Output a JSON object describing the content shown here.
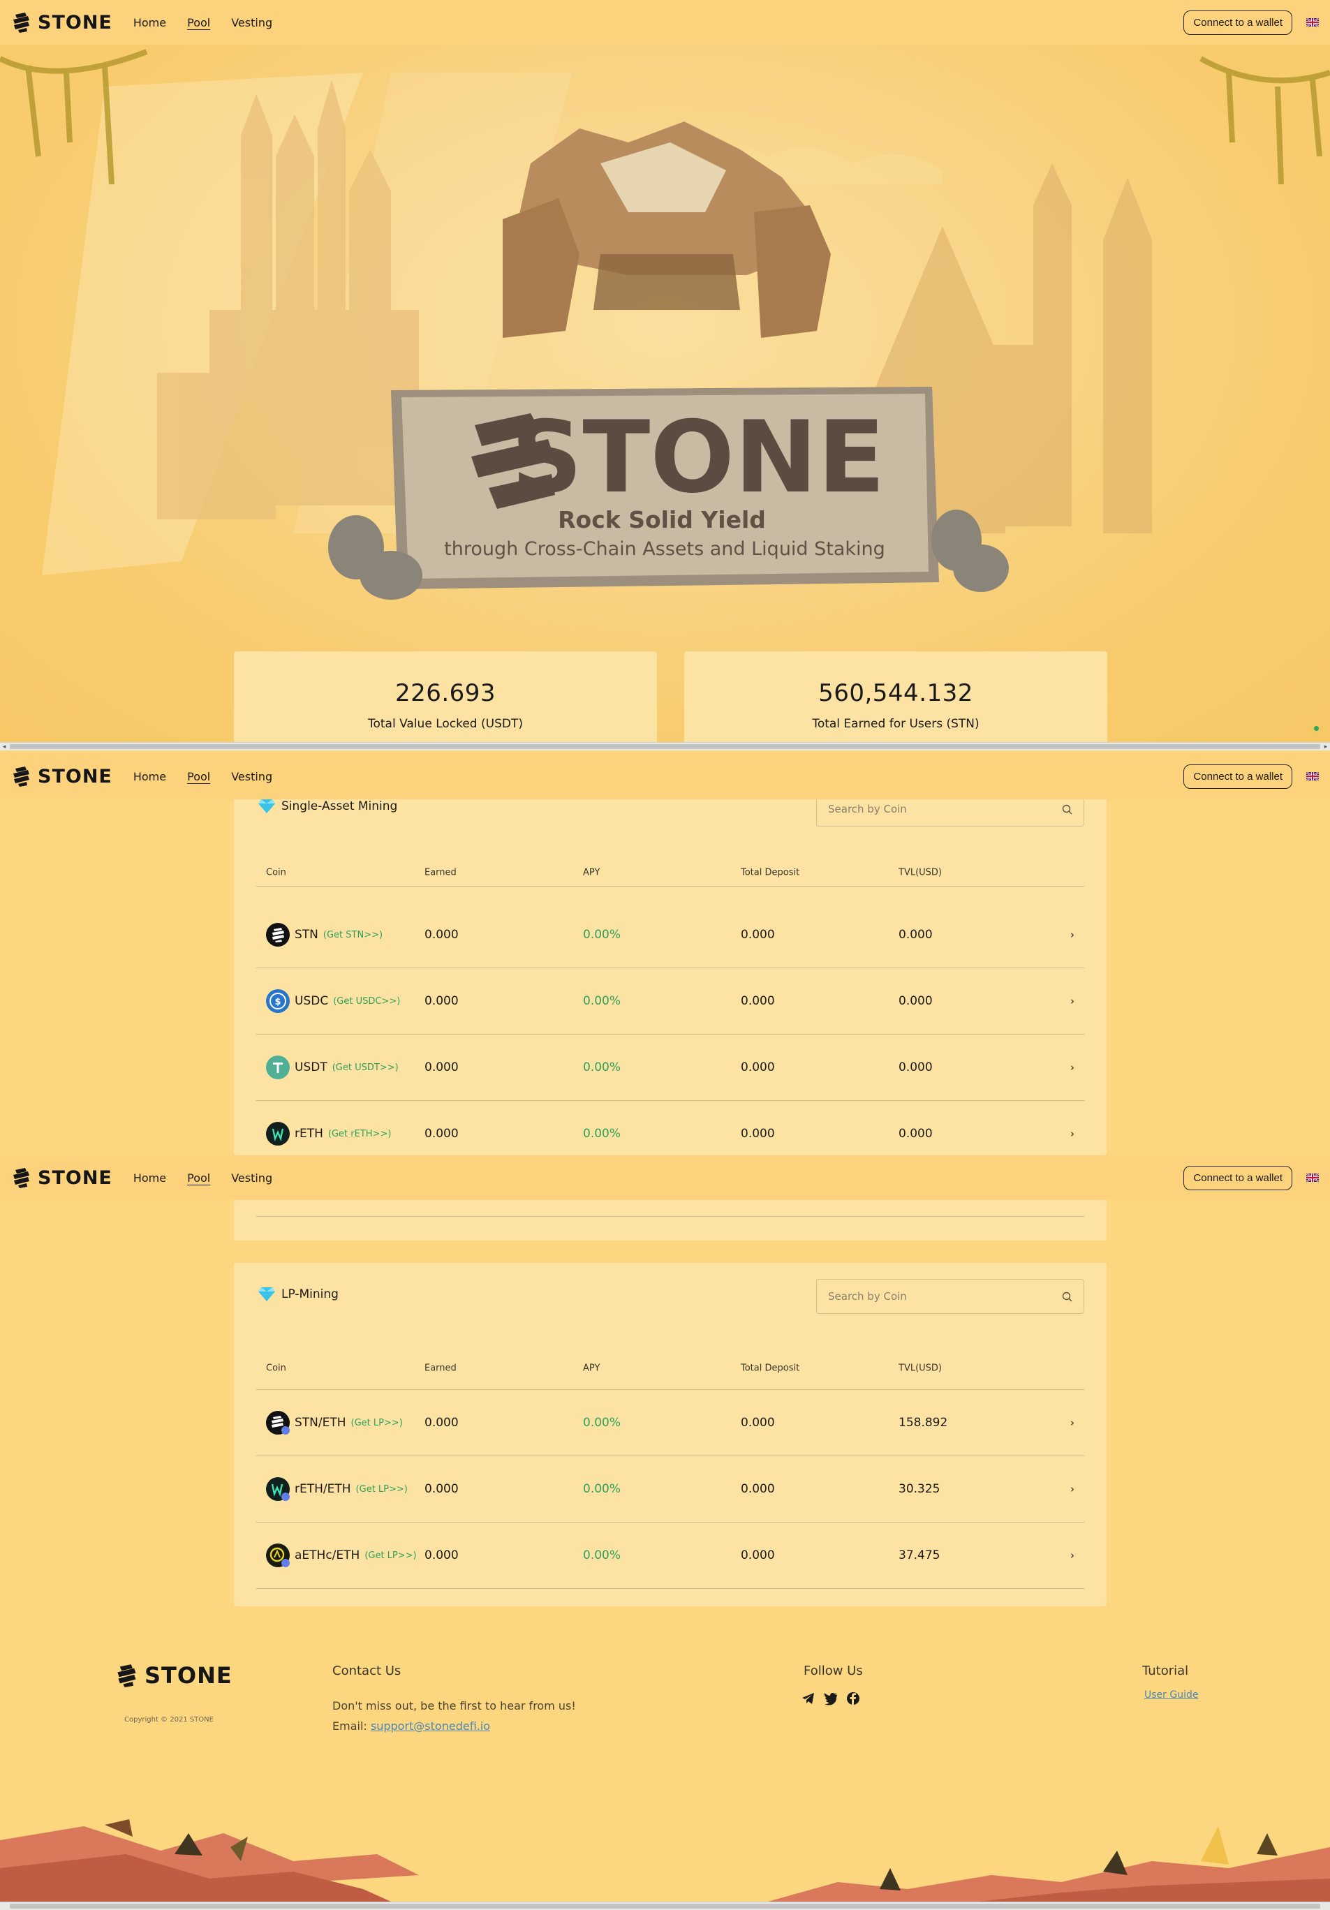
{
  "nav": {
    "brand": "STONE",
    "links": [
      "Home",
      "Pool",
      "Vesting"
    ],
    "active": "Pool",
    "connect_label": "Connect to a wallet",
    "language_icon": "uk-flag-icon"
  },
  "hero": {
    "sign_brand": "STONE",
    "tagline": "Rock Solid Yield",
    "subtagline": "through Cross-Chain Assets and Liquid Staking"
  },
  "stats": [
    {
      "value": "226.693",
      "label": "Total Value Locked (USDT)"
    },
    {
      "value": "560,544.132",
      "label": "Total Earned for Users (STN)"
    }
  ],
  "single_asset": {
    "title": "Single-Asset Mining",
    "search_placeholder": "Search by Coin",
    "headers": [
      "Coin",
      "Earned",
      "APY",
      "Total Deposit",
      "TVL(USD)"
    ],
    "rows": [
      {
        "coin": "STN",
        "link": "(Get STN>>)",
        "earned": "0.000",
        "apy": "0.00%",
        "deposit": "0.000",
        "tvl": "0.000"
      },
      {
        "coin": "USDC",
        "link": "(Get USDC>>)",
        "earned": "0.000",
        "apy": "0.00%",
        "deposit": "0.000",
        "tvl": "0.000"
      },
      {
        "coin": "USDT",
        "link": "(Get USDT>>)",
        "earned": "0.000",
        "apy": "0.00%",
        "deposit": "0.000",
        "tvl": "0.000"
      },
      {
        "coin": "rETH",
        "link": "(Get rETH>>)",
        "earned": "0.000",
        "apy": "0.00%",
        "deposit": "0.000",
        "tvl": "0.000"
      }
    ]
  },
  "lp_mining": {
    "title": "LP-Mining",
    "search_placeholder": "Search by Coin",
    "headers": [
      "Coin",
      "Earned",
      "APY",
      "Total Deposit",
      "TVL(USD)"
    ],
    "rows": [
      {
        "coin": "STN/ETH",
        "link": "(Get LP>>)",
        "earned": "0.000",
        "apy": "0.00%",
        "deposit": "0.000",
        "tvl": "158.892"
      },
      {
        "coin": "rETH/ETH",
        "link": "(Get LP>>)",
        "earned": "0.000",
        "apy": "0.00%",
        "deposit": "0.000",
        "tvl": "30.325"
      },
      {
        "coin": "aETHc/ETH",
        "link": "(Get LP>>)",
        "earned": "0.000",
        "apy": "0.00%",
        "deposit": "0.000",
        "tvl": "37.475"
      }
    ]
  },
  "footer": {
    "brand": "STONE",
    "copyright": "Copyright © 2021 STONE",
    "contact_title": "Contact Us",
    "contact_text": "Don't miss out, be the first to hear from us!",
    "email_label": "Email:",
    "email": "support@stonedefi.io",
    "follow_title": "Follow Us",
    "social_icons": [
      "telegram-icon",
      "twitter-icon",
      "facebook-icon"
    ],
    "tutorial_title": "Tutorial",
    "tutorial_link": "User Guide"
  }
}
